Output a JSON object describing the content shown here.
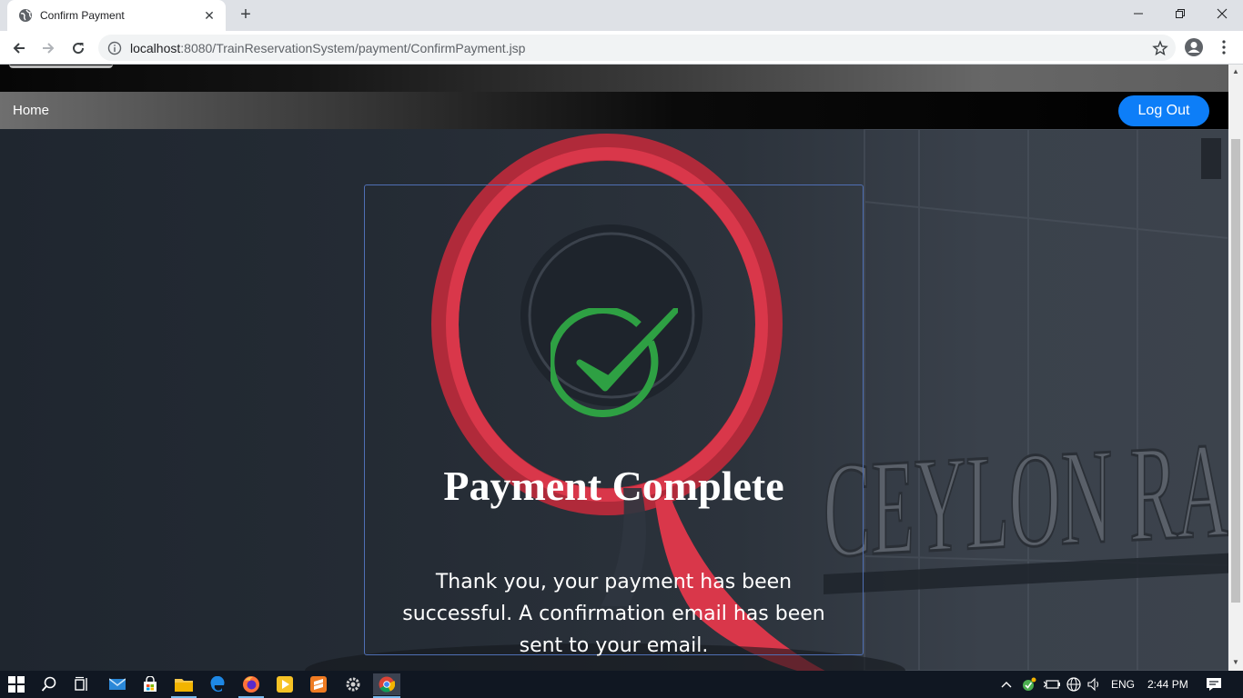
{
  "browser": {
    "tab_title": "Confirm Payment",
    "new_tab_symbol": "+",
    "tab_close_symbol": "✕",
    "url_host": "localhost",
    "url_rest": ":8080/TrainReservationSystem/payment/ConfirmPayment.jsp",
    "icons": [
      "globe-icon",
      "back-icon",
      "forward-icon",
      "reload-icon",
      "info-icon",
      "star-icon",
      "profile-icon",
      "menu-icon",
      "minimize-icon",
      "restore-icon",
      "close-icon"
    ]
  },
  "nav": {
    "home_label": "Home",
    "logout_label": "Log Out",
    "logout_color": "#0d7ef8"
  },
  "background": {
    "sign_text": "CEYLON RA",
    "q_color": "#d9374a"
  },
  "payment": {
    "title": "Payment Complete",
    "message": "Thank you, your payment has been successful. A confirmation email has been sent to your email.",
    "check_color": "#2ea043",
    "card_border_color": "#4f6fb4"
  },
  "taskbar": {
    "language": "ENG",
    "time": "2:44 PM",
    "icons": [
      "windows-start-icon",
      "search-icon",
      "task-view-icon",
      "mail-icon",
      "store-icon",
      "file-explorer-icon",
      "edge-icon",
      "firefox-icon",
      "media-player-icon",
      "sublime-icon",
      "settings-icon",
      "chrome-icon",
      "chevron-up-icon",
      "shield-check-icon",
      "battery-icon",
      "network-icon",
      "volume-icon",
      "notification-icon"
    ]
  }
}
